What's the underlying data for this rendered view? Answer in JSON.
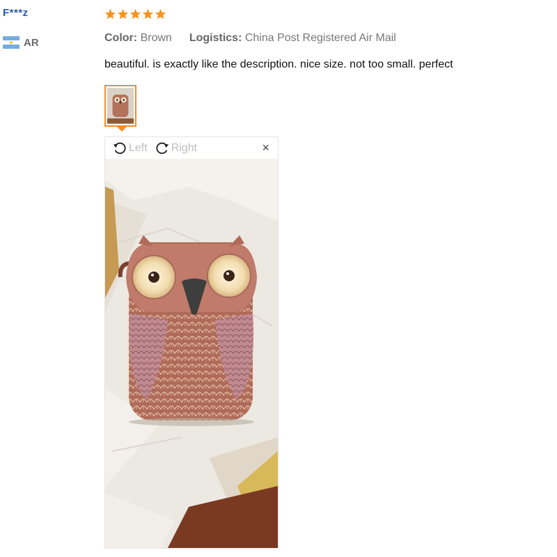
{
  "reviewer": {
    "name": "F***z",
    "country_code": "AR",
    "flag_icon": "argentina-flag-icon"
  },
  "rating": {
    "stars": 5,
    "max": 5,
    "color": "#f7931e"
  },
  "attributes": [
    {
      "key": "Color:",
      "value": "Brown"
    },
    {
      "key": "Logistics:",
      "value": "China Post Registered Air Mail"
    }
  ],
  "review_text": "beautiful. is exactly like the description. nice size. not too small. perfect",
  "image_viewer": {
    "rotate_left_label": "Left",
    "rotate_right_label": "Right",
    "close_label": "×",
    "photo_subject": "owl-shaped-brown-bag"
  },
  "colors": {
    "username": "#2a5aa8",
    "thumb_border": "#f08d2e"
  }
}
